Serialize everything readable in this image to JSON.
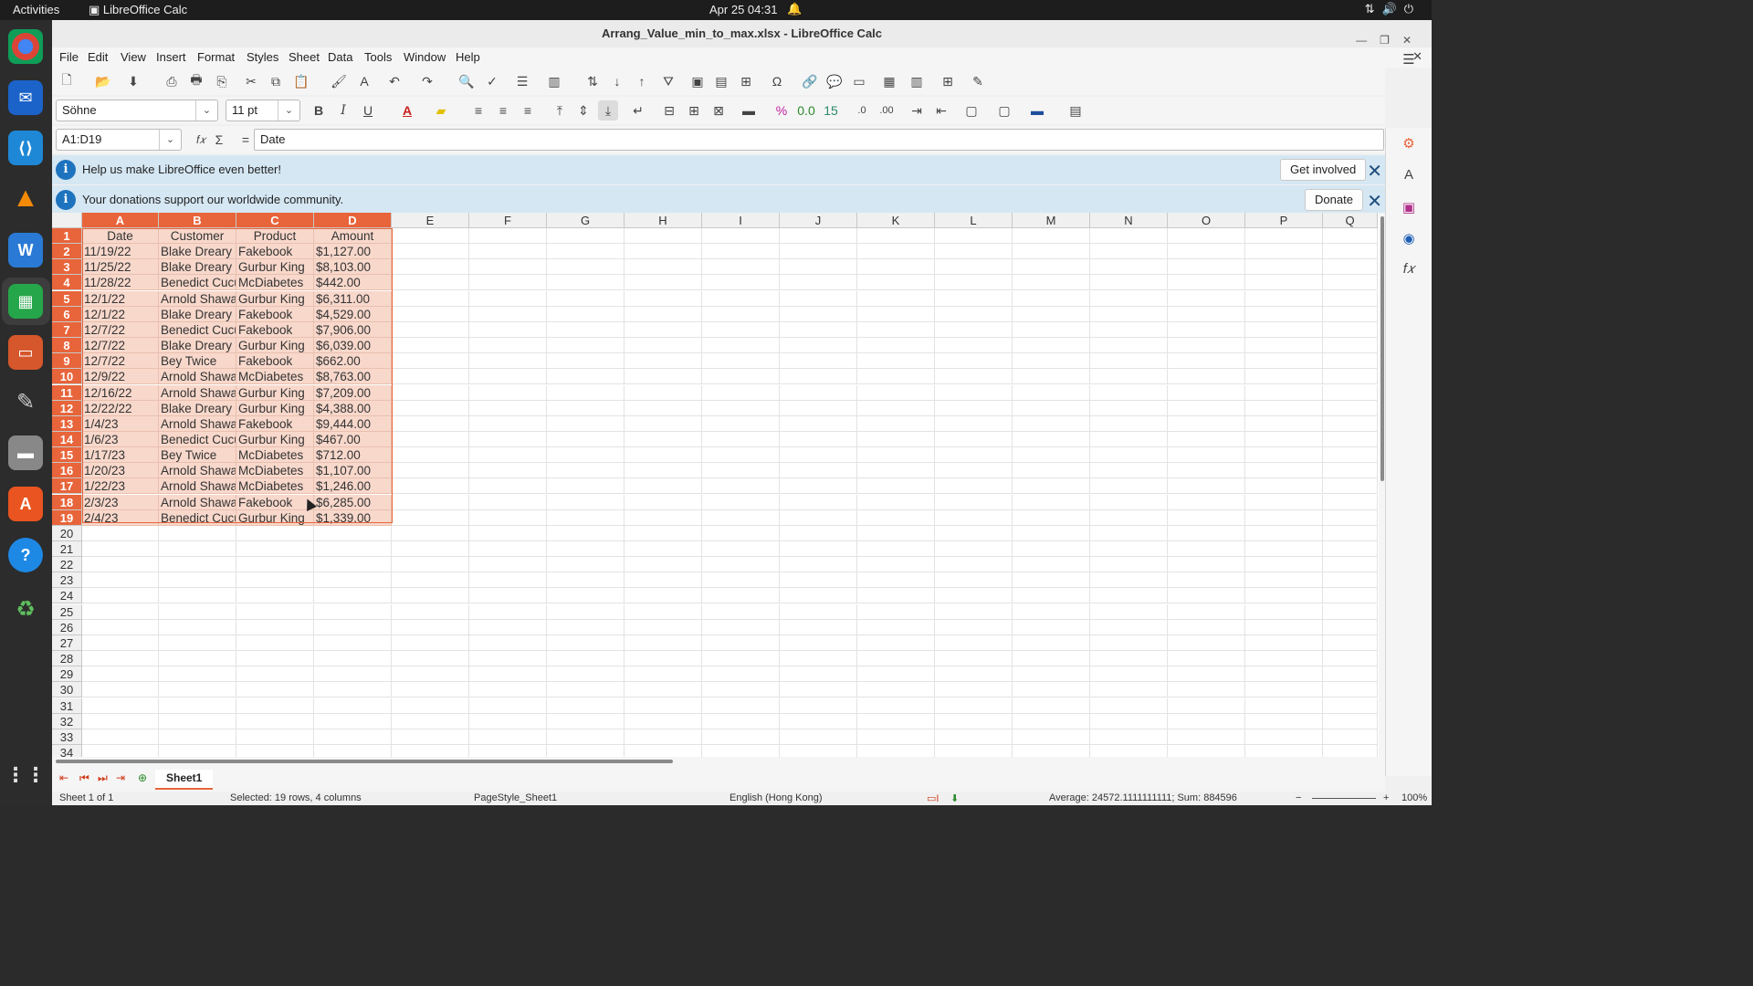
{
  "topbar": {
    "activities": "Activities",
    "app_name": "LibreOffice Calc",
    "clock": "Apr 25  04:31"
  },
  "window": {
    "title": "Arrang_Value_min_to_max.xlsx - LibreOffice Calc"
  },
  "menu": [
    "File",
    "Edit",
    "View",
    "Insert",
    "Format",
    "Styles",
    "Sheet",
    "Data",
    "Tools",
    "Window",
    "Help"
  ],
  "format_bar": {
    "font_name": "Söhne",
    "font_size": "11 pt"
  },
  "formula_bar": {
    "name_box": "A1:D19",
    "content": "Date"
  },
  "infobars": [
    {
      "text": "Help us make LibreOffice even better!",
      "button": "Get involved"
    },
    {
      "text": "Your donations support our worldwide community.",
      "button": "Donate"
    }
  ],
  "columns": [
    "A",
    "B",
    "C",
    "D",
    "E",
    "F",
    "G",
    "H",
    "I",
    "J",
    "K",
    "L",
    "M",
    "N",
    "O",
    "P",
    "Q"
  ],
  "rows": [
    "1",
    "2",
    "3",
    "4",
    "5",
    "6",
    "7",
    "8",
    "9",
    "10",
    "11",
    "12",
    "13",
    "14",
    "15",
    "16",
    "17",
    "18",
    "19",
    "20",
    "21",
    "22",
    "23",
    "24",
    "25",
    "26",
    "27",
    "28",
    "29",
    "30",
    "31",
    "32",
    "33",
    "34"
  ],
  "table": {
    "headers": [
      "Date",
      "Customer",
      "Product",
      "Amount"
    ],
    "data": [
      [
        "11/19/22",
        "Blake Dreary",
        "Fakebook",
        "$1,127.00"
      ],
      [
        "11/25/22",
        "Blake Dreary",
        "Gurbur King",
        "$8,103.00"
      ],
      [
        "11/28/22",
        "Benedict Cucumber",
        "McDiabetes",
        "$442.00"
      ],
      [
        "12/1/22",
        "Arnold Shawarma",
        "Gurbur King",
        "$6,311.00"
      ],
      [
        "12/1/22",
        "Blake Dreary",
        "Fakebook",
        "$4,529.00"
      ],
      [
        "12/7/22",
        "Benedict Cucumber",
        "Fakebook",
        "$7,906.00"
      ],
      [
        "12/7/22",
        "Blake Dreary",
        "Gurbur King",
        "$6,039.00"
      ],
      [
        "12/7/22",
        "Bey Twice",
        "Fakebook",
        "$662.00"
      ],
      [
        "12/9/22",
        "Arnold Shawarma",
        "McDiabetes",
        "$8,763.00"
      ],
      [
        "12/16/22",
        "Arnold Shawarma",
        "Gurbur King",
        "$7,209.00"
      ],
      [
        "12/22/22",
        "Blake Dreary",
        "Gurbur King",
        "$4,388.00"
      ],
      [
        "1/4/23",
        "Arnold Shawarma",
        "Fakebook",
        "$9,444.00"
      ],
      [
        "1/6/23",
        "Benedict Cucumber",
        "Gurbur King",
        "$467.00"
      ],
      [
        "1/17/23",
        "Bey Twice",
        "McDiabetes",
        "$712.00"
      ],
      [
        "1/20/23",
        "Arnold Shawarma",
        "McDiabetes",
        "$1,107.00"
      ],
      [
        "1/22/23",
        "Arnold Shawarma",
        "McDiabetes",
        "$1,246.00"
      ],
      [
        "2/3/23",
        "Arnold Shawarma",
        "Fakebook",
        "$6,285.00"
      ],
      [
        "2/4/23",
        "Benedict Cucumber",
        "Gurbur King",
        "$1,339.00"
      ]
    ]
  },
  "sheet_tab": "Sheet1",
  "status": {
    "sheet": "Sheet 1 of 1",
    "selection": "Selected: 19 rows, 4 columns",
    "page_style": "PageStyle_Sheet1",
    "language": "English (Hong Kong)",
    "summary": "Average: 24572.1111111111; Sum: 884596",
    "zoom": "100%"
  },
  "colors": {
    "selection_header": "#e8643a",
    "selection_fill": "#f8d8cb",
    "infobar": "#d5e7f3"
  }
}
